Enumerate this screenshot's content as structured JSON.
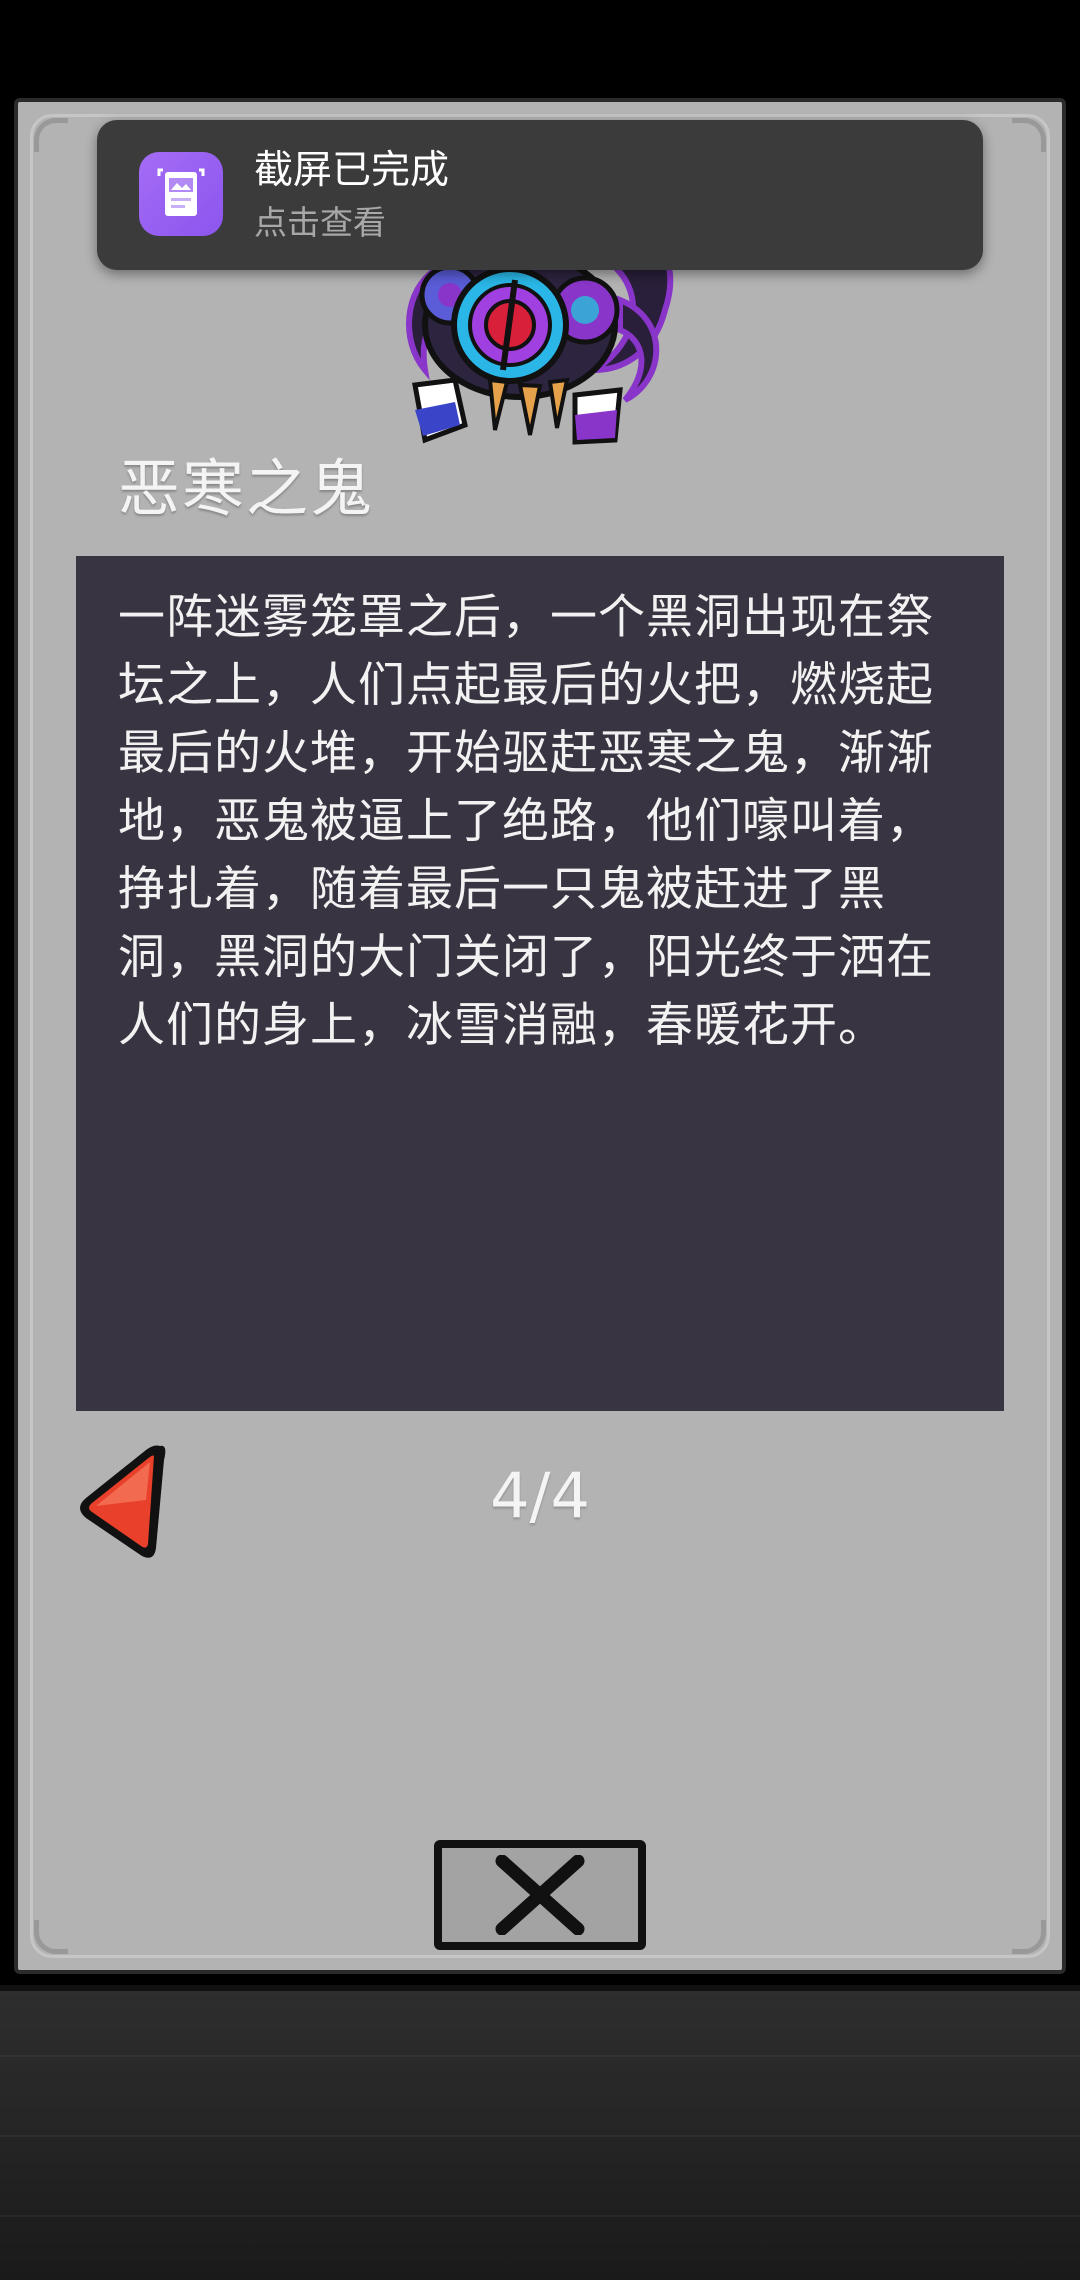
{
  "toast": {
    "title": "截屏已完成",
    "subtitle": "点击查看",
    "icon": "screenshot-gallery-icon",
    "icon_color": "#9a62f2"
  },
  "dialog": {
    "monster_title": "恶寒之鬼",
    "story": "一阵迷雾笼罩之后，一个黑洞出现在祭坛之上，人们点起最后的火把，燃烧起最后的火堆，开始驱赶恶寒之鬼，渐渐地，恶鬼被逼上了绝路，他们嚎叫着，挣扎着，随着最后一只鬼被赶进了黑洞，黑洞的大门关闭了，阳光终于洒在人们的身上，冰雪消融，春暖花开。",
    "page": "4/4",
    "prev_icon": "red-left-arrow-icon",
    "close_icon": "close-x-icon",
    "panel_color": "#b3b3b3",
    "story_bg_color": "#393441"
  }
}
